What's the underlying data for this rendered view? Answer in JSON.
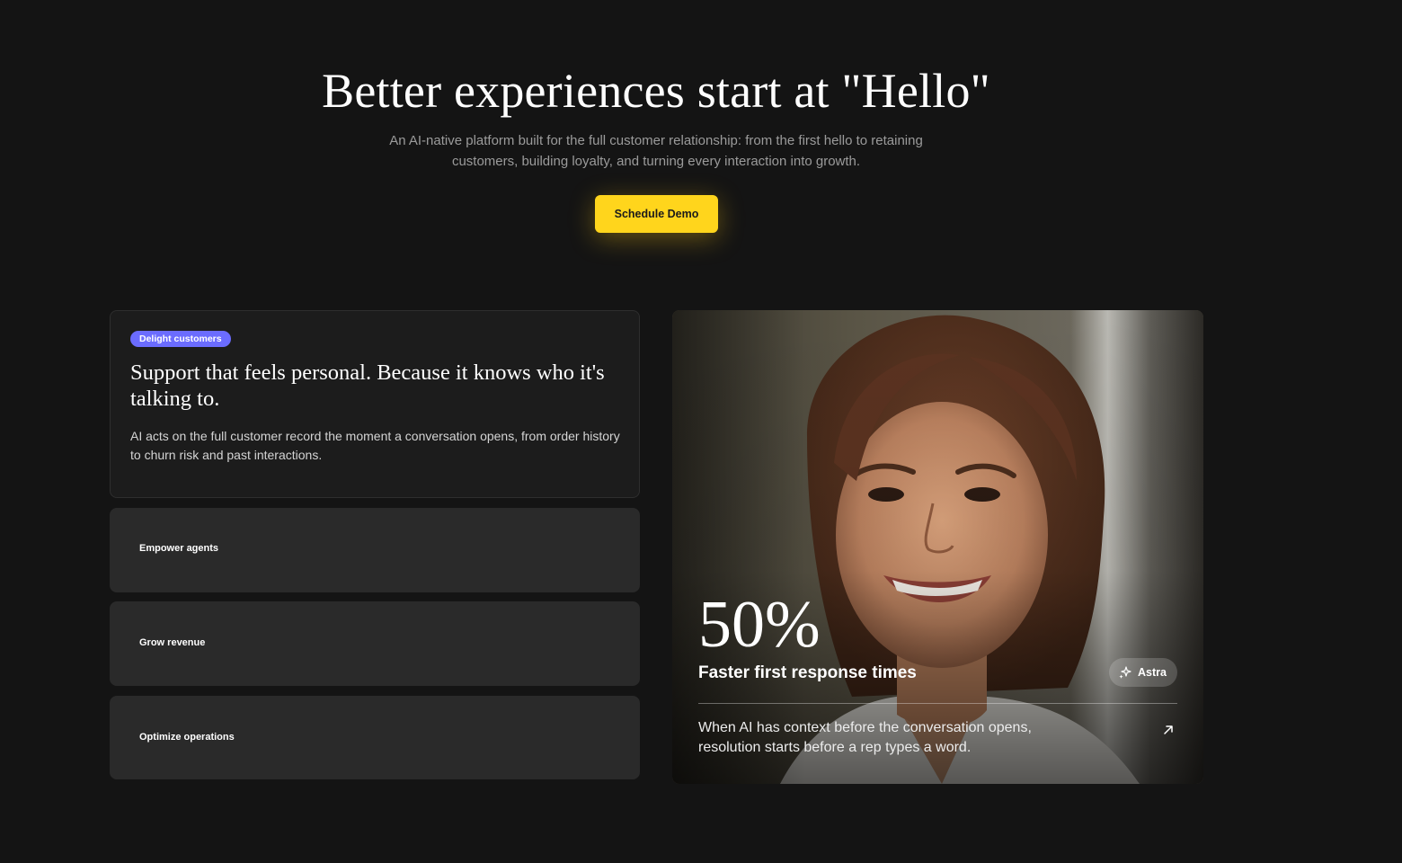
{
  "hero": {
    "title": "Better experiences start at \"Hello\"",
    "subtitle": "An AI-native platform built for the full customer relationship: from the first hello to retaining customers, building loyalty, and turning every interaction into growth.",
    "cta_label": "Schedule Demo"
  },
  "features": {
    "active": {
      "tag": "Delight customers",
      "title": "Support that feels personal. Because it knows who it's talking to.",
      "description": "AI acts on the full customer record the moment a conversation opens, from order history to churn risk and past interactions."
    },
    "items": [
      {
        "label": "Empower agents"
      },
      {
        "label": "Grow revenue"
      },
      {
        "label": "Optimize operations"
      }
    ]
  },
  "stat_card": {
    "value": "50%",
    "label": "Faster first response times",
    "badge": "Astra",
    "badge_icon": "sparkle-icon",
    "description": "When AI has context before the conversation opens, resolution starts before a rep types a word.",
    "link_icon": "arrow-up-right-icon"
  },
  "colors": {
    "background": "#141414",
    "cta": "#ffd51c",
    "tag": "#6b6cff",
    "card": "#2a2a2a"
  }
}
